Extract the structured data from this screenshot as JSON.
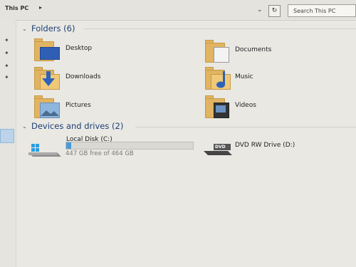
{
  "address": {
    "location": "This PC",
    "arrow": "▸"
  },
  "toolbar": {
    "dropdown": "⌄",
    "refresh": "↻"
  },
  "search": {
    "placeholder": "Search This PC"
  },
  "sections": {
    "folders": {
      "label": "Folders (6)"
    },
    "devices": {
      "label": "Devices and drives (2)"
    }
  },
  "folders": [
    {
      "label": "Desktop",
      "icon": "desktop-folder-icon"
    },
    {
      "label": "Documents",
      "icon": "documents-folder-icon"
    },
    {
      "label": "Downloads",
      "icon": "downloads-folder-icon"
    },
    {
      "label": "Music",
      "icon": "music-folder-icon"
    },
    {
      "label": "Pictures",
      "icon": "pictures-folder-icon"
    },
    {
      "label": "Videos",
      "icon": "videos-folder-icon"
    }
  ],
  "drives": [
    {
      "label": "Local Disk (C:)",
      "free_text": "447 GB free of 464 GB",
      "used_fraction": 0.037,
      "icon": "windows-drive-icon"
    },
    {
      "label": "DVD RW Drive (D:)",
      "badge": "DVD",
      "icon": "dvd-drive-icon"
    }
  ],
  "colors": {
    "accent": "#1e3f73",
    "folder": "#e1b462",
    "bar_fill": "#4b9ad8"
  }
}
